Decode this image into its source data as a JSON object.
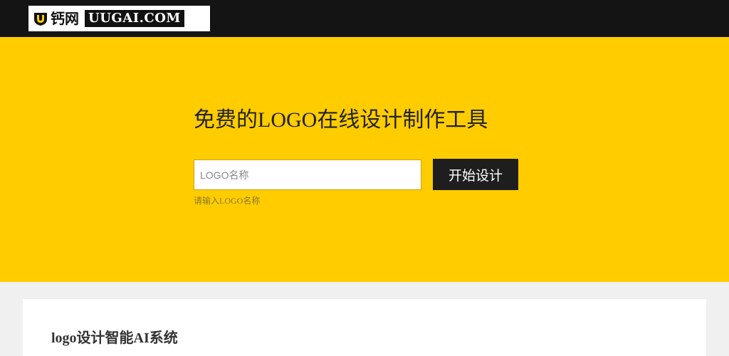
{
  "header": {
    "logo": {
      "cn_text": "钙网",
      "en_text": "UUGAI.COM",
      "icon": "shield-u-icon"
    }
  },
  "hero": {
    "title": "免费的LOGO在线设计制作工具",
    "input": {
      "placeholder": "LOGO名称",
      "value": ""
    },
    "button_label": "开始设计",
    "hint": "请输入LOGO名称"
  },
  "section": {
    "title": "logo设计智能AI系统"
  },
  "colors": {
    "hero_bg": "#ffcc00",
    "topbar_bg": "#141414",
    "button_bg": "#1e1e1e",
    "page_bg": "#f0f0f0"
  }
}
